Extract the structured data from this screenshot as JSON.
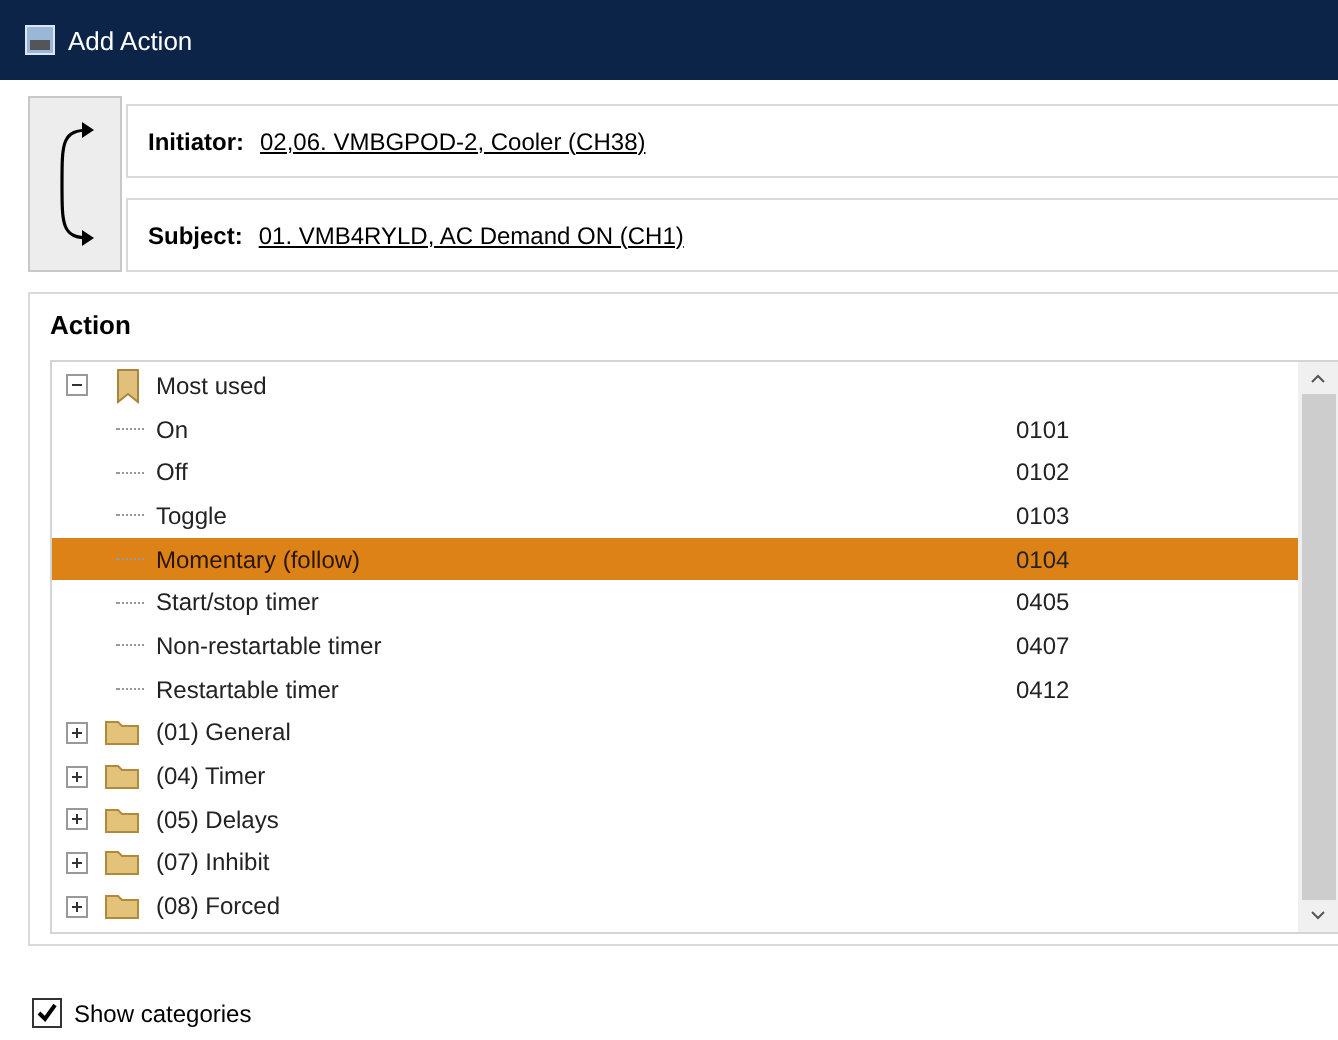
{
  "window": {
    "title": "Add Action"
  },
  "initiator": {
    "label": "Initiator:",
    "value": "02,06. VMBGPOD-2, Cooler (CH38)"
  },
  "subject": {
    "label": "Subject:",
    "value": "01. VMB4RYLD, AC Demand ON (CH1)"
  },
  "action": {
    "title": "Action",
    "tree": [
      {
        "label": "Most used",
        "kind": "bookmark",
        "expanded": true,
        "children": [
          {
            "label": "On",
            "code": "0101",
            "selected": false
          },
          {
            "label": "Off",
            "code": "0102",
            "selected": false
          },
          {
            "label": "Toggle",
            "code": "0103",
            "selected": false
          },
          {
            "label": "Momentary (follow)",
            "code": "0104",
            "selected": true
          },
          {
            "label": "Start/stop timer",
            "code": "0405",
            "selected": false
          },
          {
            "label": "Non-restartable timer",
            "code": "0407",
            "selected": false
          },
          {
            "label": "Restartable timer",
            "code": "0412",
            "selected": false
          }
        ]
      },
      {
        "label": "(01) General",
        "kind": "folder",
        "expanded": false
      },
      {
        "label": "(04) Timer",
        "kind": "folder",
        "expanded": false
      },
      {
        "label": "(05) Delays",
        "kind": "folder",
        "expanded": false
      },
      {
        "label": "(07) Inhibit",
        "kind": "folder",
        "expanded": false
      },
      {
        "label": "(08) Forced",
        "kind": "folder",
        "expanded": false
      }
    ]
  },
  "show_categories": {
    "label": "Show categories",
    "checked": true
  }
}
